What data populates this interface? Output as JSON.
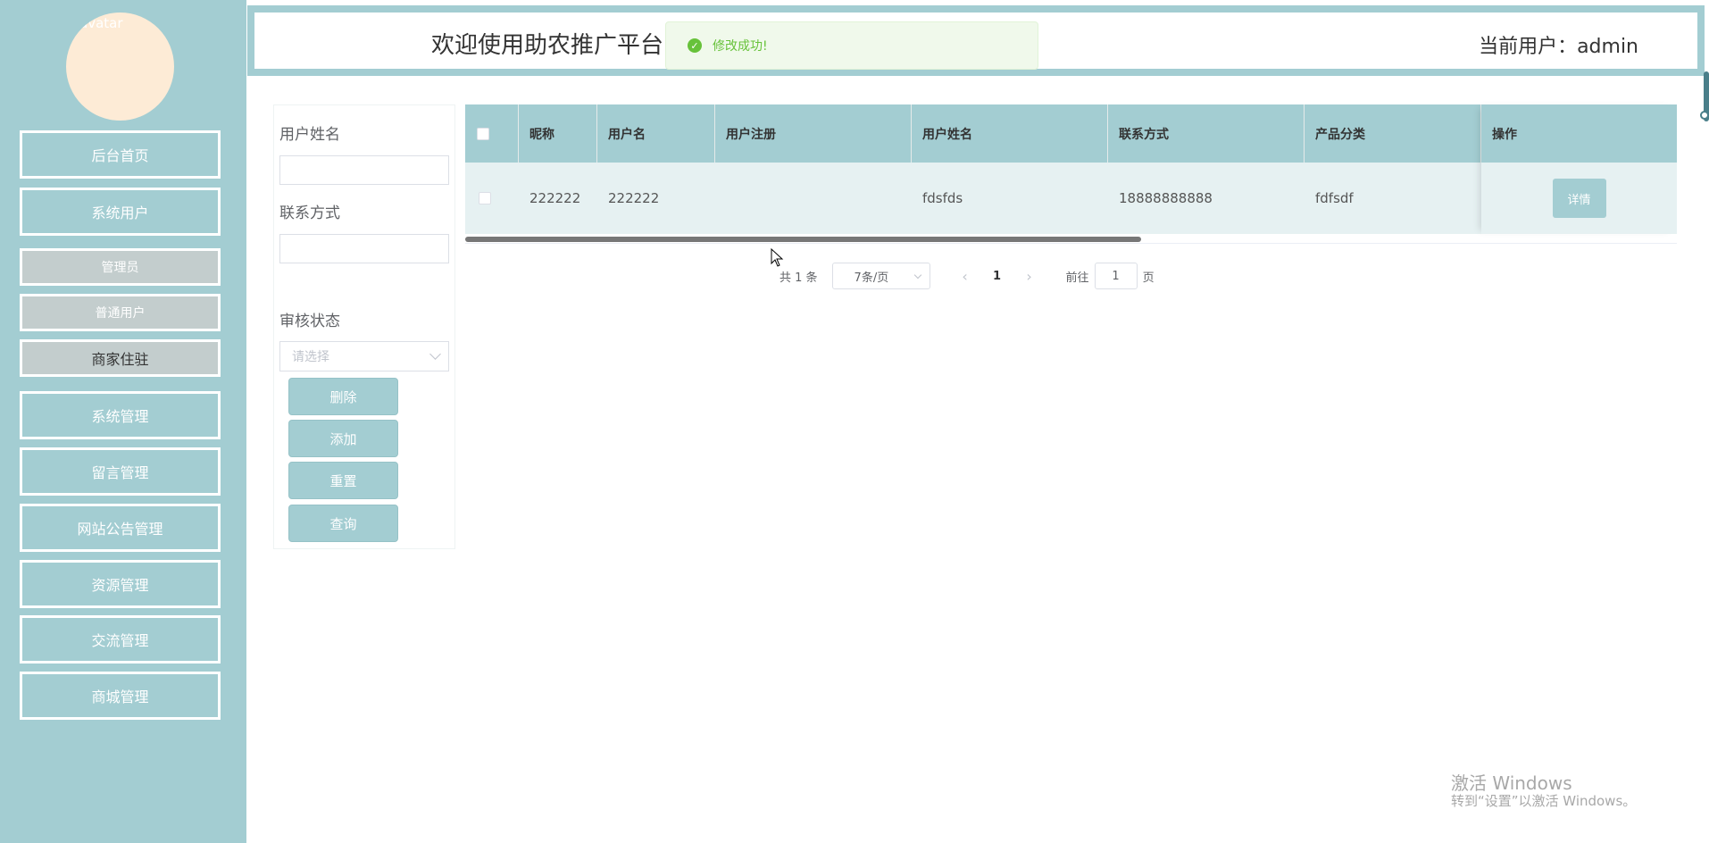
{
  "sidebar": {
    "avatar_alt": "avatar",
    "items": [
      {
        "label": "后台首页"
      },
      {
        "label": "系统用户"
      },
      {
        "label": "系统管理"
      },
      {
        "label": "留言管理"
      },
      {
        "label": "网站公告管理"
      },
      {
        "label": "资源管理"
      },
      {
        "label": "交流管理"
      },
      {
        "label": "商城管理"
      }
    ],
    "subitems": [
      {
        "label": "管理员"
      },
      {
        "label": "普通用户"
      },
      {
        "label": "商家住驻"
      }
    ]
  },
  "header": {
    "title": "欢迎使用助农推广平台",
    "user_label": "当前用户：admin"
  },
  "toast": {
    "icon": "check-icon",
    "message": "修改成功!"
  },
  "filter": {
    "name_label": "用户姓名",
    "name_value": "",
    "phone_label": "联系方式",
    "phone_value": "",
    "status_label": "审核状态",
    "status_placeholder": "请选择",
    "buttons": {
      "delete": "删除",
      "add": "添加",
      "reset": "重置",
      "query": "查询"
    }
  },
  "table": {
    "columns": [
      "昵称",
      "用户名",
      "用户注册",
      "用户姓名",
      "联系方式",
      "产品分类",
      "操作"
    ],
    "rows": [
      {
        "nickname": "222222",
        "username": "222222",
        "register": "",
        "realname": "fdsfds",
        "phone": "18888888888",
        "category": "fdfsdf",
        "action": "详情"
      }
    ]
  },
  "pagination": {
    "total": "共 1 条",
    "page_size": "7条/页",
    "prev": "‹",
    "current_page": "1",
    "next": "›",
    "goto_prefix": "前往",
    "goto_value": "1",
    "goto_suffix": "页"
  },
  "watermark": {
    "line1": "激活 Windows",
    "line2": "转到“设置”以激活 Windows。"
  },
  "colors": {
    "primary": "#a3cdd2",
    "success": "#67c23a",
    "row_bg": "#e6f1f2"
  }
}
